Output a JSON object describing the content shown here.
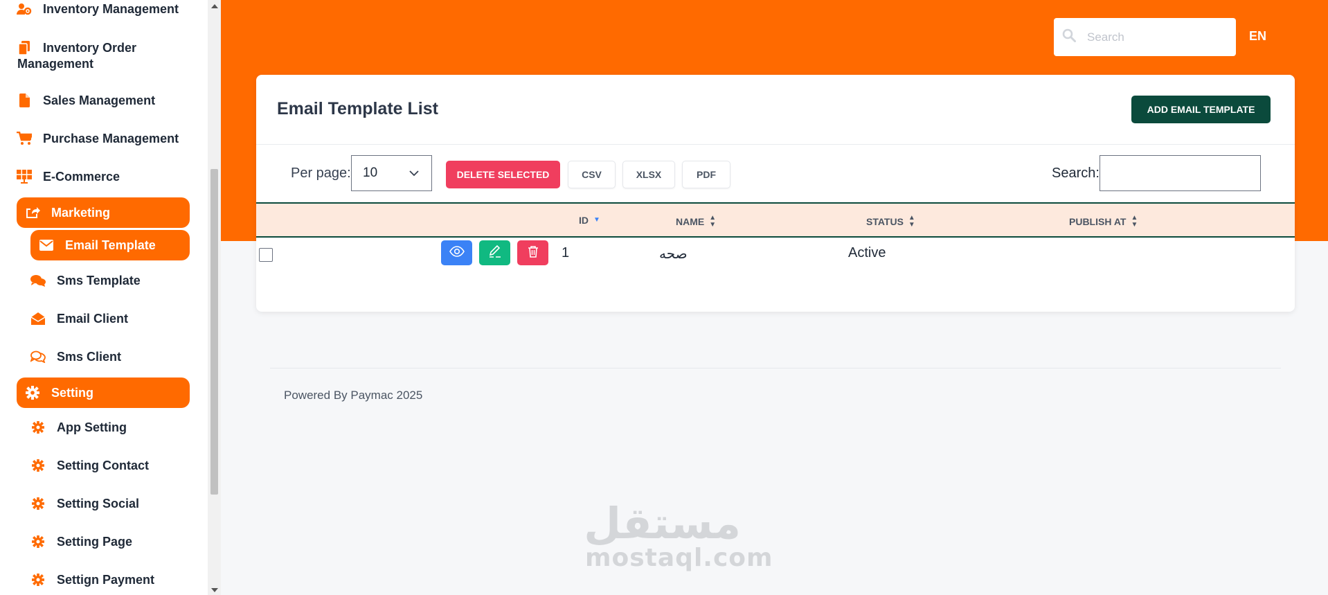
{
  "sidebar": {
    "items": [
      {
        "label": "Inventory Management",
        "icon": "users-cog-icon"
      },
      {
        "label": "Inventory Order",
        "label2": "Management",
        "icon": "copy-icon"
      },
      {
        "label": "Sales Management",
        "icon": "file-icon"
      },
      {
        "label": "Purchase Management",
        "icon": "cart-icon"
      },
      {
        "label": "E-Commerce",
        "icon": "solar-panel-icon"
      },
      {
        "label": "Marketing",
        "icon": "share-square-icon"
      },
      {
        "label": "Email Template",
        "icon": "envelope-icon"
      },
      {
        "label": "Sms Template",
        "icon": "comments-icon"
      },
      {
        "label": "Email Client",
        "icon": "envelope-open-icon"
      },
      {
        "label": "Sms Client",
        "icon": "comments-outline-icon"
      },
      {
        "label": "Setting",
        "icon": "gear-icon"
      },
      {
        "label": "App Setting",
        "icon": "gear-icon"
      },
      {
        "label": "Setting Contact",
        "icon": "gear-icon"
      },
      {
        "label": "Setting Social",
        "icon": "gear-icon"
      },
      {
        "label": "Setting Page",
        "icon": "gear-icon"
      },
      {
        "label": "Settign Payment",
        "icon": "gear-icon"
      }
    ]
  },
  "header": {
    "search_placeholder": "Search",
    "language": "EN"
  },
  "colors": {
    "brand": "#ff6a00",
    "primary_dark": "#0b4a3c",
    "danger": "#f03e5e",
    "info": "#3b82f6",
    "success": "#10b981"
  },
  "card": {
    "title": "Email Template List",
    "add_button": "ADD EMAIL TEMPLATE",
    "per_page_label": "Per page:",
    "per_page_value": "10",
    "delete_selected": "DELETE SELECTED",
    "export": {
      "csv": "CSV",
      "xlsx": "XLSX",
      "pdf": "PDF"
    },
    "search_label": "Search:"
  },
  "table": {
    "columns": [
      "ID",
      "NAME",
      "STATUS",
      "PUBLISH AT"
    ],
    "rows": [
      {
        "id": "1",
        "name": "صحه",
        "status": "Active",
        "publish_at": ""
      }
    ]
  },
  "footer": {
    "text": "Powered By Paymac 2025"
  },
  "watermark": {
    "arabic": "مستقل",
    "latin": "mostaql.com"
  }
}
